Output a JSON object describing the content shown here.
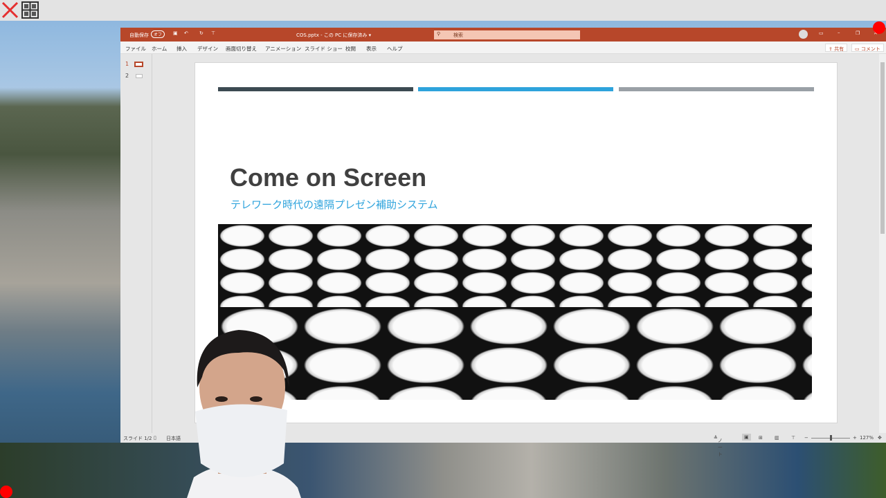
{
  "overlay": {
    "close_icon": "red-x-icon",
    "layout_icon": "grid-icon"
  },
  "titlebar": {
    "autosave_label": "自動保存",
    "autosave_state": "オフ",
    "filename": "COS.pptx - この PC に保存済み ▾",
    "search_placeholder": "検索",
    "accent": "#b7472a"
  },
  "menu": [
    "ファイル",
    "ホーム",
    "挿入",
    "デザイン",
    "画面切り替え",
    "アニメーション",
    "スライド ショー",
    "校閲",
    "表示",
    "ヘルプ"
  ],
  "ribbon_right": {
    "share": "共有",
    "comment": "コメント"
  },
  "thumbnails": [
    "1",
    "2"
  ],
  "slide": {
    "title": "Come on Screen",
    "subtitle": "テレワーク時代の遠隔プレゼン補助システム",
    "bar_colors": [
      "#3c4a52",
      "#2ea3dc",
      "#9aa0a6"
    ]
  },
  "status": {
    "slide": "スライド 1/2",
    "language": "日本語",
    "notes": "ノート",
    "zoom": "127%"
  }
}
